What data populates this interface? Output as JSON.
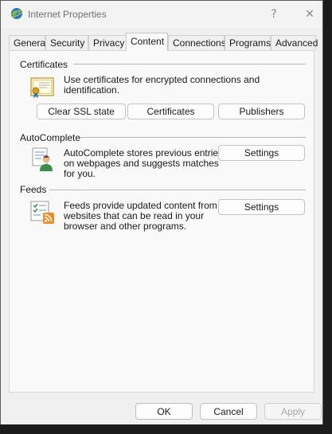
{
  "window": {
    "title": "Internet Properties",
    "help_glyph": "?",
    "close_glyph": "✕"
  },
  "tabs": [
    {
      "label": "General"
    },
    {
      "label": "Security"
    },
    {
      "label": "Privacy"
    },
    {
      "label": "Content",
      "active": true
    },
    {
      "label": "Connections"
    },
    {
      "label": "Programs"
    },
    {
      "label": "Advanced"
    }
  ],
  "certificates": {
    "heading": "Certificates",
    "description": "Use certificates for encrypted connections and identification.",
    "clear_ssl_label": "Clear SSL state",
    "certificates_label": "Certificates",
    "publishers_label": "Publishers"
  },
  "autocomplete": {
    "heading": "AutoComplete",
    "line1": "AutoComplete stores previous entries",
    "line2": "on webpages and suggests matches",
    "line3": "for you.",
    "settings_label": "Settings"
  },
  "feeds": {
    "heading": "Feeds",
    "line1": "Feeds provide updated content from",
    "line2": "websites that can be read in your",
    "line3": "browser and other programs.",
    "settings_label": "Settings"
  },
  "footer": {
    "ok_label": "OK",
    "cancel_label": "Cancel",
    "apply_label": "Apply"
  },
  "colors": {
    "dialog_bg": "#f0f0f0",
    "panel_bg": "#f9f9f9",
    "disabled_text": "#a8a8a8"
  }
}
